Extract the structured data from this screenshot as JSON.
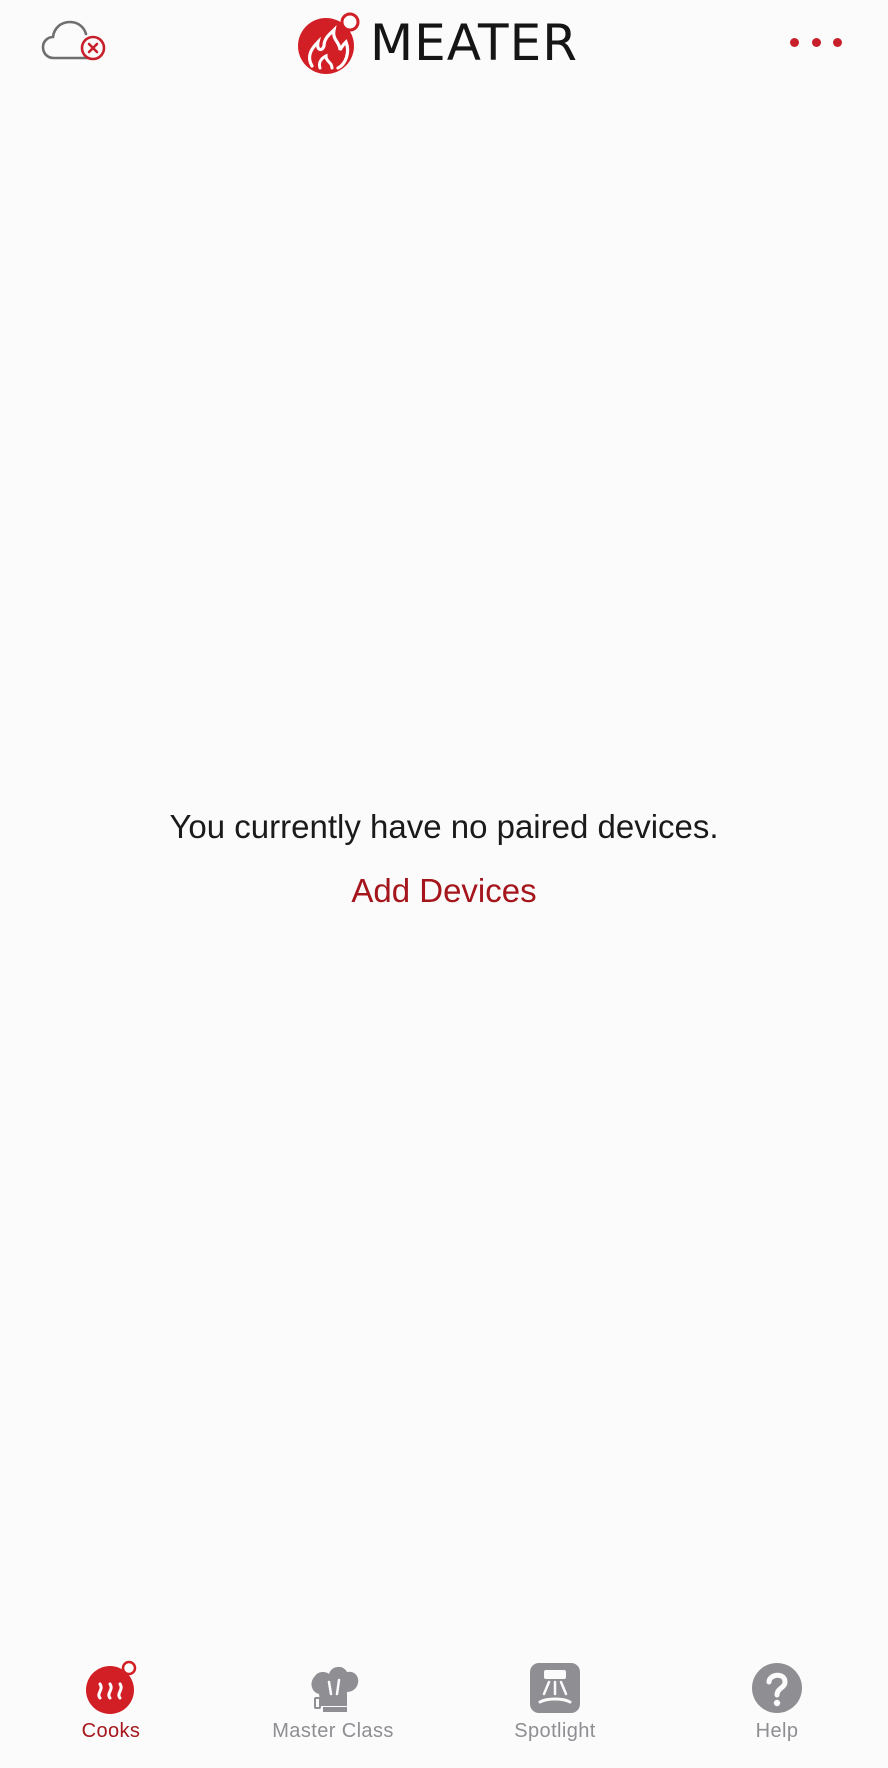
{
  "header": {
    "app_name": "MEATER",
    "cloud_icon": "cloud-disconnected-icon",
    "more_icon": "more-horizontal-icon"
  },
  "empty_state": {
    "message": "You currently have no paired devices.",
    "action_label": "Add Devices"
  },
  "tabs": [
    {
      "label": "Cooks",
      "icon": "cooks-icon",
      "active": true
    },
    {
      "label": "Master Class",
      "icon": "chef-hat-icon",
      "active": false
    },
    {
      "label": "Spotlight",
      "icon": "spotlight-icon",
      "active": false
    },
    {
      "label": "Help",
      "icon": "help-icon",
      "active": false
    }
  ],
  "colors": {
    "accent": "#c8202a",
    "link": "#a4161c",
    "inactive": "#8e8e93",
    "background": "#fbfbfb"
  }
}
